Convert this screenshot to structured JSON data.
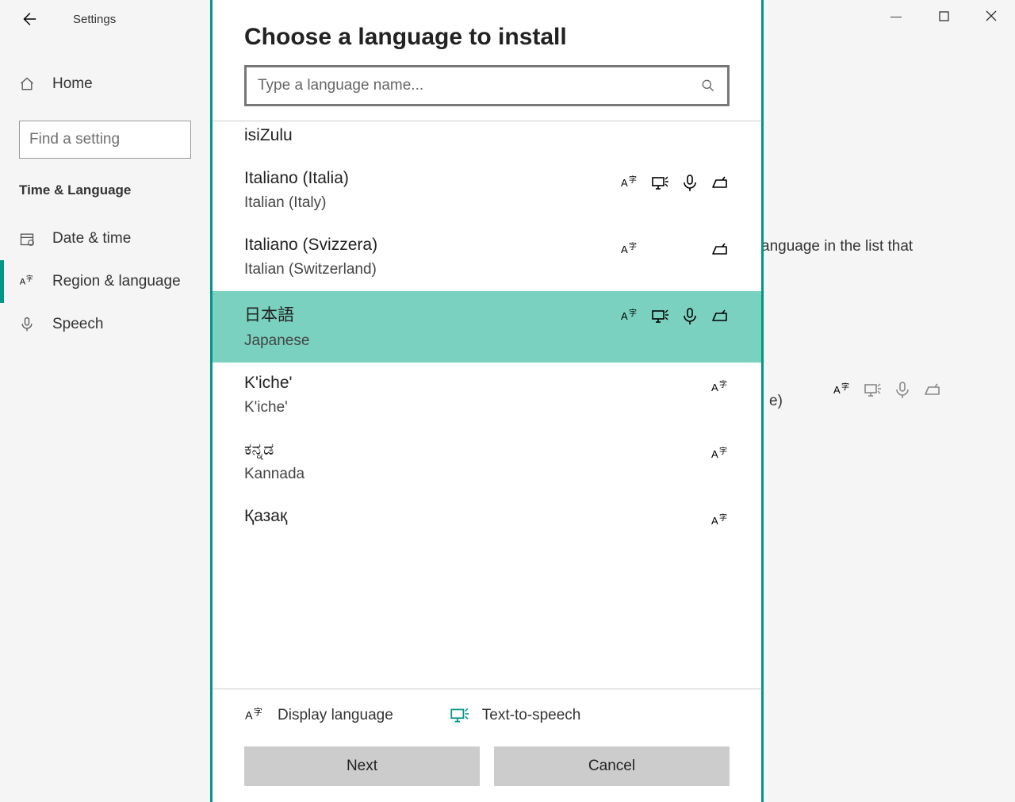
{
  "window": {
    "title": "Settings",
    "home": "Home",
    "search_placeholder": "Find a setting",
    "section": "Time & Language",
    "nav": {
      "datetime": "Date & time",
      "region": "Region & language",
      "speech": "Speech"
    },
    "right_hint": "anguage in the list that",
    "right_hint2": "e)"
  },
  "modal": {
    "title": "Choose a language to install",
    "search_placeholder": "Type a language name...",
    "languages": [
      {
        "native": "isiZulu",
        "english": "",
        "features": []
      },
      {
        "native": "Italiano (Italia)",
        "english": "Italian (Italy)",
        "features": [
          "display",
          "tts",
          "speech",
          "hand"
        ]
      },
      {
        "native": "Italiano (Svizzera)",
        "english": "Italian (Switzerland)",
        "features": [
          "display",
          "",
          "",
          "hand"
        ]
      },
      {
        "native": "日本語",
        "english": "Japanese",
        "features": [
          "display",
          "tts",
          "speech",
          "hand"
        ],
        "selected": true
      },
      {
        "native": "K'iche'",
        "english": "K'iche'",
        "features": [
          "display"
        ]
      },
      {
        "native": "ಕನ್ನಡ",
        "english": "Kannada",
        "features": [
          "display"
        ]
      },
      {
        "native": "Қазақ",
        "english": "",
        "features": [
          "display"
        ]
      }
    ],
    "legend": {
      "display": "Display language",
      "tts": "Text-to-speech"
    },
    "buttons": {
      "next": "Next",
      "cancel": "Cancel"
    }
  }
}
